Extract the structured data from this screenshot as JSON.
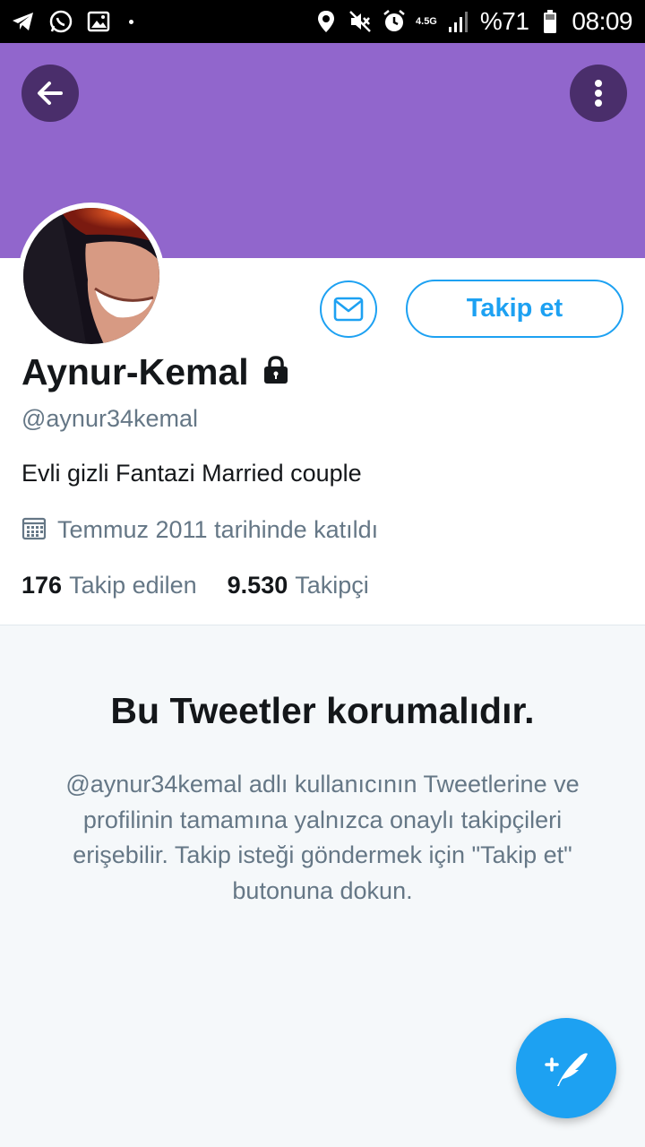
{
  "status_bar": {
    "network": "4.5G",
    "battery": "%71",
    "time": "08:09",
    "left_icons": [
      "telegram-icon",
      "whatsapp-icon",
      "gallery-icon"
    ],
    "right_icons": [
      "location-icon",
      "mute-icon",
      "alarm-icon",
      "signal-icon",
      "battery-icon"
    ]
  },
  "header": {
    "banner_color": "#9166cc",
    "back_icon": "arrow-left-icon",
    "menu_icon": "more-vertical-icon"
  },
  "profile": {
    "name": "Aynur-Kemal",
    "handle": "@aynur34kemal",
    "bio": "Evli gizli Fantazi Married couple",
    "joined": "Temmuz 2011 tarihinde katıldı",
    "following_count": "176",
    "following_label": "Takip edilen",
    "followers_count": "9.530",
    "followers_label": "Takipçi",
    "follow_button": "Takip et",
    "accent_color": "#1da1f2"
  },
  "protected": {
    "title": "Bu Tweetler korumalıdır.",
    "description": "@aynur34kemal adlı kullanıcının Tweetlerine ve profilinin tamamına yalnızca onaylı takipçileri erişebilir. Takip isteği göndermek için \"Takip et\" butonuna dokun."
  },
  "fab": {
    "icon": "compose-tweet-icon"
  }
}
